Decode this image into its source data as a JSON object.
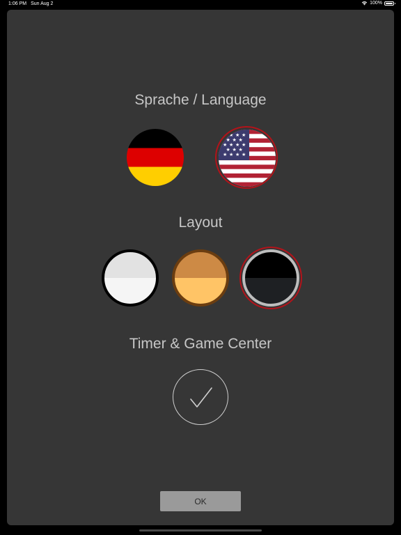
{
  "status_bar": {
    "time": "1:06 PM",
    "date": "Sun Aug 2",
    "battery": "100%"
  },
  "sections": {
    "language_title": "Sprache / Language",
    "layout_title": "Layout",
    "timer_title": "Timer & Game Center"
  },
  "language": {
    "options": [
      "german-flag",
      "us-flag"
    ],
    "selected": "us-flag"
  },
  "layout": {
    "options": [
      "light",
      "orange",
      "dark"
    ],
    "selected": "dark"
  },
  "timer": {
    "enabled": true
  },
  "ok_button": {
    "label": "OK"
  },
  "colors": {
    "sheet": "#363636",
    "selection_ring": "#b3131a",
    "title_text": "#c7c7c7",
    "button": "#9a9a9a"
  }
}
